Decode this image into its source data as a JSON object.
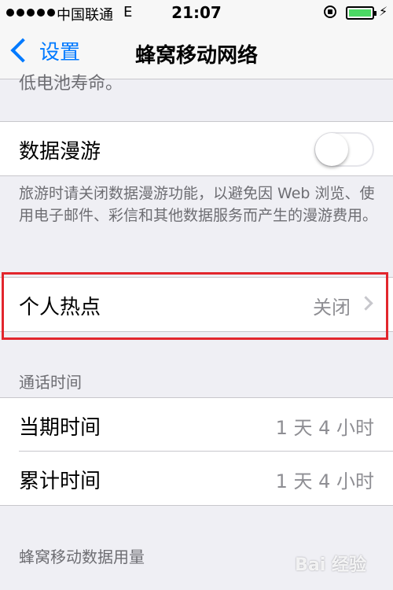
{
  "status_bar": {
    "carrier": "中国联通",
    "network": "E",
    "time": "21:07"
  },
  "nav": {
    "back_label": "设置",
    "title": "蜂窝移动网络"
  },
  "cut_text": "低电池寿命。",
  "roaming": {
    "label": "数据漫游",
    "enabled": false,
    "footer": "旅游时请关闭数据漫游功能，以避免因 Web 浏览、使用电子邮件、彩信和其他数据服务而产生的漫游费用。"
  },
  "hotspot": {
    "label": "个人热点",
    "value": "关闭"
  },
  "call_time": {
    "header": "通话时间",
    "rows": [
      {
        "label": "当期时间",
        "value": "1 天 4 小时"
      },
      {
        "label": "累计时间",
        "value": "1 天 4 小时"
      }
    ]
  },
  "cellular_usage": {
    "header": "蜂窝移动数据用量"
  },
  "watermark": "Bai 经验",
  "colors": {
    "accent": "#007aff",
    "highlight": "#e2262d",
    "background": "#efeff4"
  }
}
